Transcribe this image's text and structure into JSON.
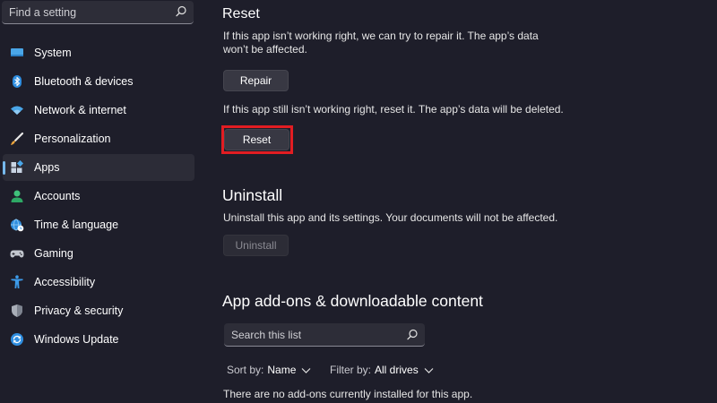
{
  "sidebar": {
    "search_placeholder": "Find a setting",
    "items": [
      {
        "label": "System",
        "icon": "system-icon"
      },
      {
        "label": "Bluetooth & devices",
        "icon": "bluetooth-icon"
      },
      {
        "label": "Network & internet",
        "icon": "wifi-icon"
      },
      {
        "label": "Personalization",
        "icon": "brush-icon"
      },
      {
        "label": "Apps",
        "icon": "apps-icon",
        "selected": true
      },
      {
        "label": "Accounts",
        "icon": "person-icon"
      },
      {
        "label": "Time & language",
        "icon": "globe-clock-icon"
      },
      {
        "label": "Gaming",
        "icon": "gamepad-icon"
      },
      {
        "label": "Accessibility",
        "icon": "accessibility-icon"
      },
      {
        "label": "Privacy & security",
        "icon": "shield-icon"
      },
      {
        "label": "Windows Update",
        "icon": "update-icon"
      }
    ]
  },
  "reset_section": {
    "title": "Reset",
    "repair_desc_line1": "If this app isn’t working right, we can try to repair it. The app’s data",
    "repair_desc_line2": "won’t be affected.",
    "repair_button": "Repair",
    "reset_desc": "If this app still isn’t working right, reset it. The app’s data will be deleted.",
    "reset_button": "Reset"
  },
  "uninstall_section": {
    "title": "Uninstall",
    "desc": "Uninstall this app and its settings. Your documents will not be affected.",
    "uninstall_button": "Uninstall"
  },
  "addons_section": {
    "title": "App add-ons & downloadable content",
    "search_placeholder": "Search this list",
    "sort_label": "Sort by:",
    "sort_value": "Name",
    "filter_label": "Filter by:",
    "filter_value": "All drives",
    "empty_message": "There are no add-ons currently installed for this app."
  },
  "colors": {
    "accent": "#76b9ed",
    "highlight": "#e21d22",
    "background": "#1e1e2a"
  }
}
